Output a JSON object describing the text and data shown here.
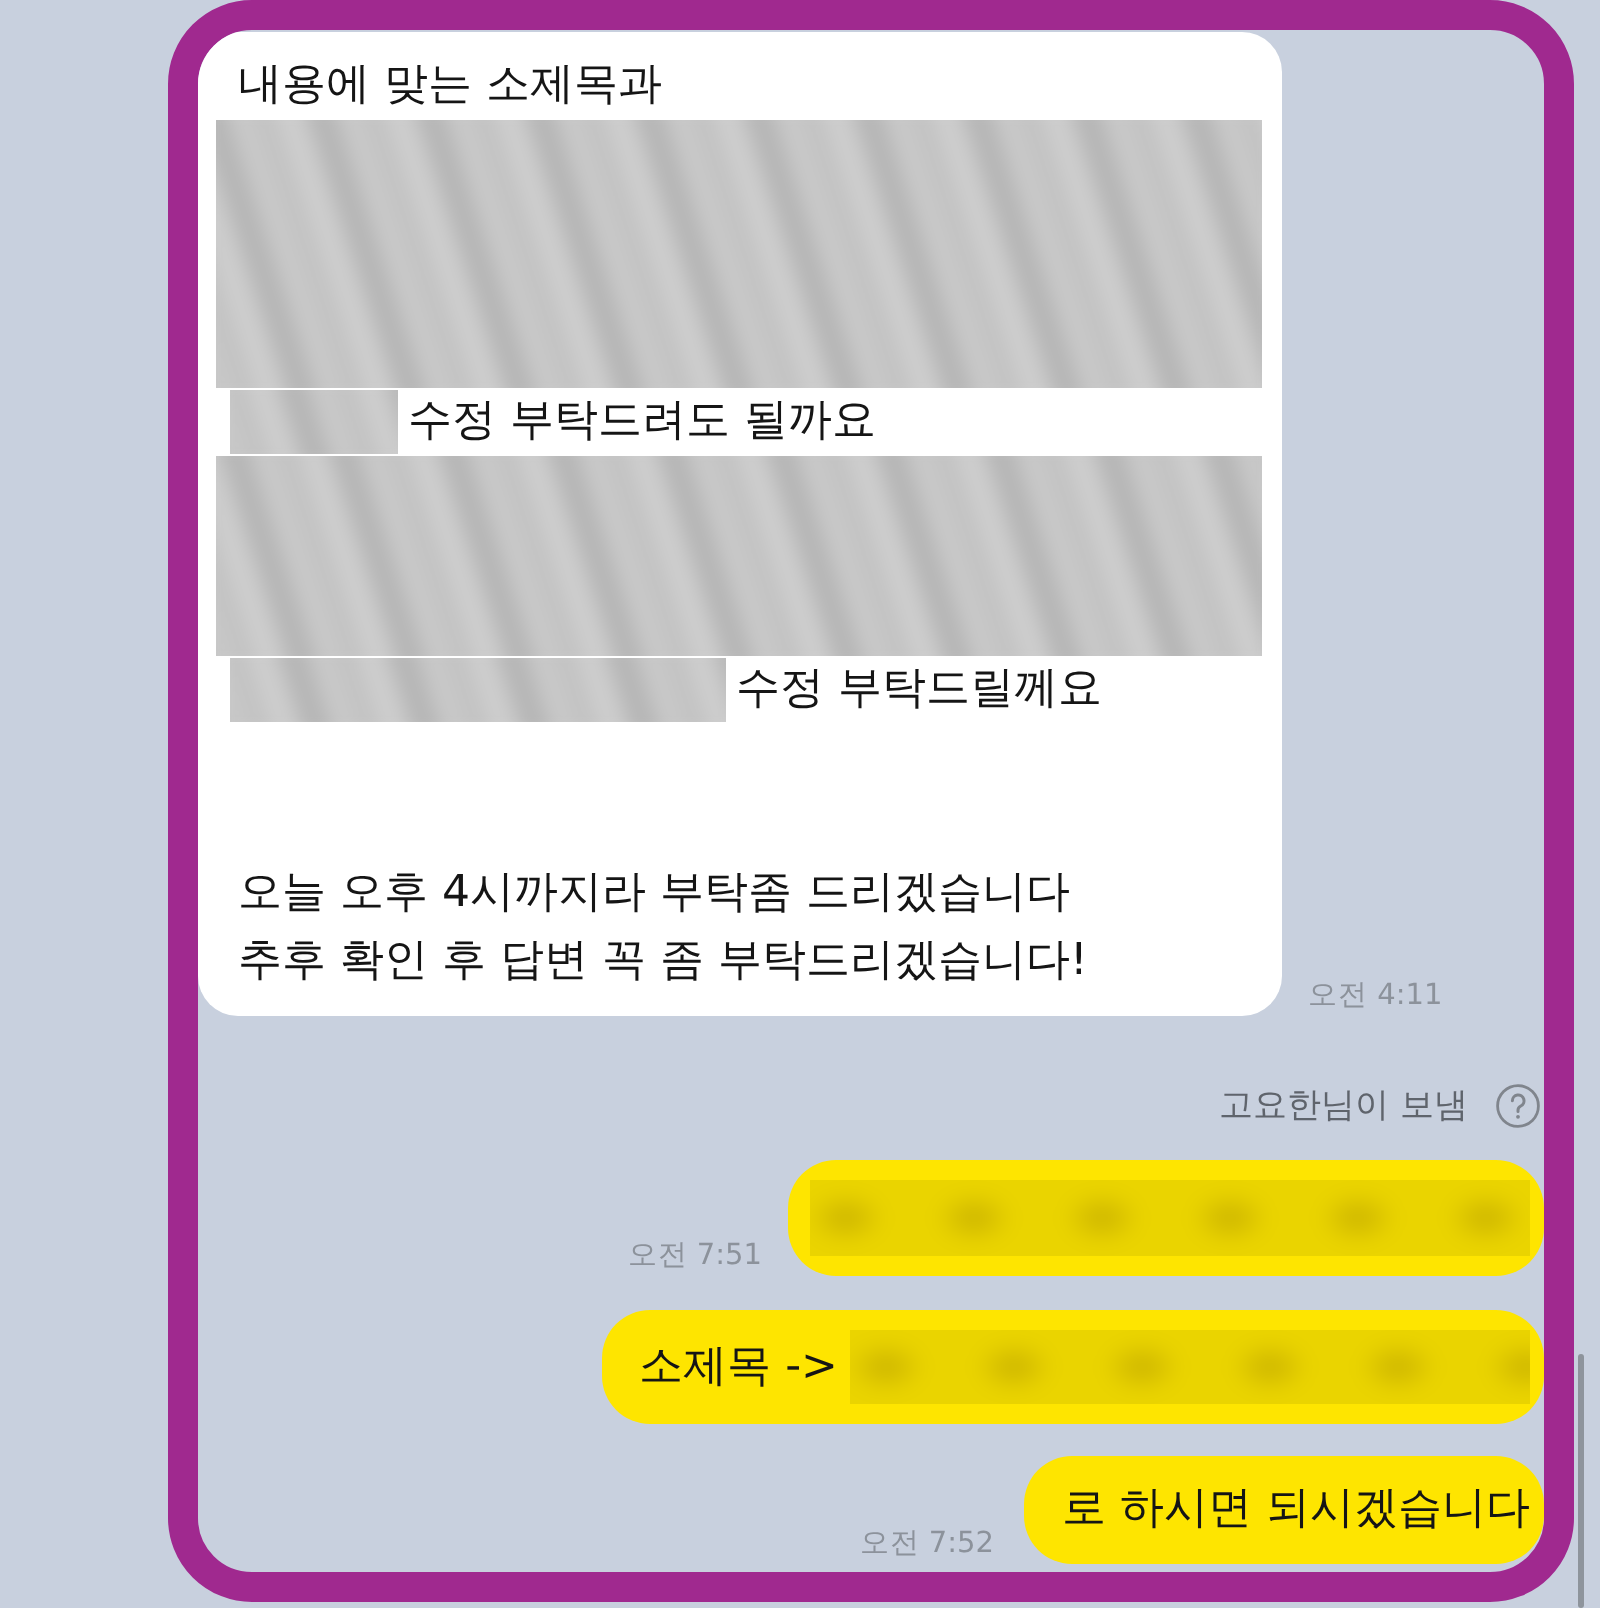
{
  "incoming_message": {
    "paragraphs": [
      [
        {
          "kind": "text",
          "text": "내용에 맞는 소제목과"
        },
        {
          "kind": "redacted"
        },
        {
          "kind": "redacted_text",
          "text": "수정 부탁드려도 될까요"
        },
        {
          "kind": "redacted"
        },
        {
          "kind": "redacted_text",
          "text": "수정 부탁드릴께요"
        }
      ],
      [
        {
          "kind": "text",
          "text": "오늘 오후 4시까지라 부탁좀 드리겠습니다"
        },
        {
          "kind": "text",
          "text": "추후 확인 후 답변 꼭 좀 부탁드리겠습니다!"
        }
      ]
    ],
    "time": "오전 4:11"
  },
  "sent_notice": {
    "text": "고요한님이 보냄"
  },
  "outgoing_messages": [
    {
      "content": [
        {
          "kind": "redacted"
        }
      ],
      "time": "오전 7:51"
    },
    {
      "content": [
        {
          "kind": "text",
          "text": "소제목 ->"
        },
        {
          "kind": "redacted"
        }
      ]
    },
    {
      "content": [
        {
          "kind": "text",
          "text": "로 하시면 되시겠습니다"
        }
      ],
      "time": "오전 7:52"
    }
  ]
}
